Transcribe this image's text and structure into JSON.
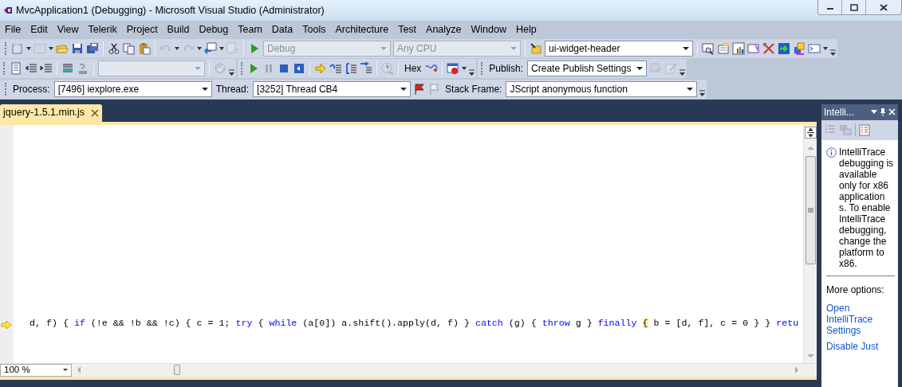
{
  "window": {
    "title": "MvcApplication1 (Debugging) - Microsoft Visual Studio (Administrator)"
  },
  "menu": [
    "File",
    "Edit",
    "View",
    "Telerik",
    "Project",
    "Build",
    "Debug",
    "Team",
    "Data",
    "Tools",
    "Architecture",
    "Test",
    "Analyze",
    "Window",
    "Help"
  ],
  "standard_toolbar": {
    "configuration": {
      "value": "Debug",
      "disabled": true
    },
    "platform": {
      "value": "Any CPU",
      "disabled": true
    },
    "find": {
      "value": "ui-widget-header"
    }
  },
  "debug_toolbar": {
    "combo": {
      "disabled": true
    },
    "hex": "Hex",
    "publish": {
      "label": "Publish:",
      "value": "Create Publish Settings"
    }
  },
  "debug_location": {
    "process": {
      "label": "Process:",
      "value": "[7496] iexplore.exe"
    },
    "thread": {
      "label": "Thread:",
      "value": "[3252] Thread CB4"
    },
    "stack_frame": {
      "label": "Stack Frame:",
      "value": "JScript anonymous function"
    }
  },
  "tabs": [
    {
      "label": "jquery-1.5.1.min.js",
      "selected": true
    }
  ],
  "editor": {
    "code_tokens": [
      {
        "kind": "plain",
        "text": "d, f) { "
      },
      {
        "kind": "keyword",
        "text": "if"
      },
      {
        "kind": "plain",
        "text": " (!e && !b && !c) { c = 1; "
      },
      {
        "kind": "keyword",
        "text": "try"
      },
      {
        "kind": "plain",
        "text": " { "
      },
      {
        "kind": "keyword",
        "text": "while"
      },
      {
        "kind": "plain",
        "text": " (a[0]) a.shift().apply(d, f) } "
      },
      {
        "kind": "keyword",
        "text": "catch"
      },
      {
        "kind": "plain",
        "text": " (g) { "
      },
      {
        "kind": "keyword",
        "text": "throw"
      },
      {
        "kind": "plain",
        "text": " g } "
      },
      {
        "kind": "keyword",
        "text": "finally "
      },
      {
        "kind": "match",
        "text": "{"
      },
      {
        "kind": "plain",
        "text": " b = [d, f], c = 0 } } "
      },
      {
        "kind": "keyword",
        "text": "retu"
      }
    ],
    "zoom": "100 %"
  },
  "intellitrace": {
    "title": "Intelli...",
    "message": "IntelliTrace debugging is available only for x86 application s.  To enable IntelliTrace debugging, change the platform to x86.",
    "more_options": "More options:",
    "links": [
      "Open IntelliTrace Settings",
      "Disable Just"
    ]
  }
}
